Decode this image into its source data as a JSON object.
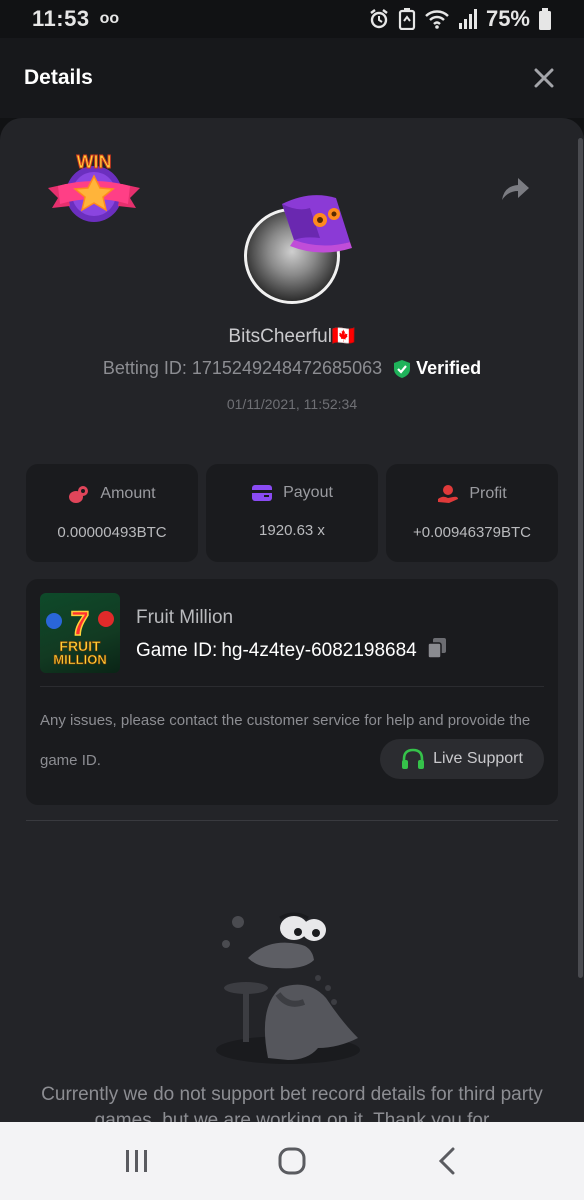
{
  "status_bar": {
    "time": "11:53",
    "voicemail_icon": "oo",
    "battery": "75%"
  },
  "header": {
    "title": "Details"
  },
  "bet": {
    "username": "BitsCheerful🇨🇦",
    "betting_id_label": "Betting ID:",
    "betting_id": "1715249248472685063",
    "verified_label": "Verified",
    "timestamp": "01/11/2021, 11:52:34"
  },
  "stats": [
    {
      "label": "Amount",
      "value": "0.00000493BTC",
      "icon": "coins-icon",
      "color": "#e0455a"
    },
    {
      "label": "Payout",
      "value": "1920.63 x",
      "icon": "wallet-icon",
      "color": "#8a4bf3"
    },
    {
      "label": "Profit",
      "value": "+0.00946379BTC",
      "icon": "hand-coin-icon",
      "color": "#e03a3a"
    }
  ],
  "game": {
    "name": "Fruit Million",
    "id_label": "Game ID:",
    "id": "hg-4z4tey-6082198684",
    "thumb_title_line1": "FRUIT",
    "thumb_title_line2": "MILLION",
    "thumb_seven": "7",
    "issue_text": "Any issues, please contact the customer service for help and provoide the game ID.",
    "support_label": "Live Support"
  },
  "empty_state": {
    "message": "Currently we do not support bet record details for third party games, but we are working on it. Thank you for"
  },
  "colors": {
    "verified_green": "#1fb25a",
    "support_green": "#35c24a",
    "sheet_bg": "#232428"
  }
}
